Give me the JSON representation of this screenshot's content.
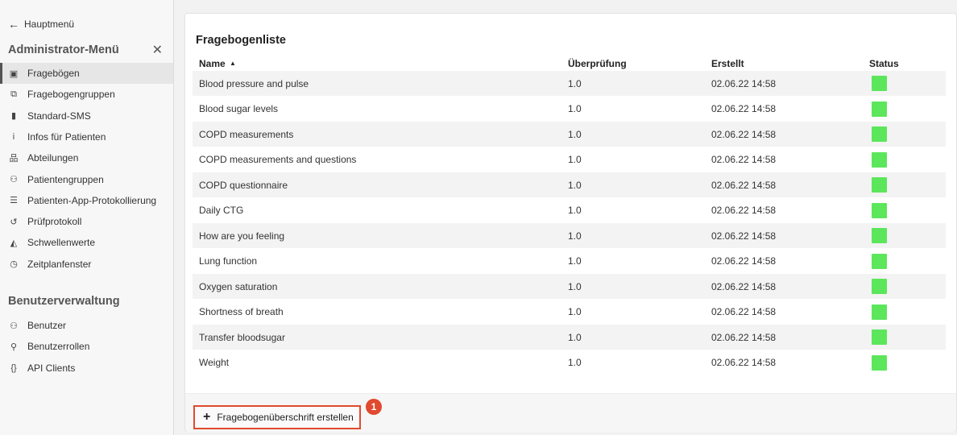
{
  "sidebar": {
    "back_label": "Hauptmenü",
    "menu_title": "Administrator-Menü",
    "close_glyph": "✕",
    "items": [
      {
        "label": "Fragebögen",
        "icon": "document-icon",
        "glyph": "▣"
      },
      {
        "label": "Fragebogengruppen",
        "icon": "documents-icon",
        "glyph": "⧉"
      },
      {
        "label": "Standard-SMS",
        "icon": "phone-icon",
        "glyph": "▮"
      },
      {
        "label": "Infos für Patienten",
        "icon": "info-icon",
        "glyph": "i"
      },
      {
        "label": "Abteilungen",
        "icon": "hierarchy-icon",
        "glyph": "品"
      },
      {
        "label": "Patientengruppen",
        "icon": "patient-group-icon",
        "glyph": "⚇"
      },
      {
        "label": "Patienten-App-Protokollierung",
        "icon": "log-lines-icon",
        "glyph": "☰"
      },
      {
        "label": "Prüfprotokoll",
        "icon": "history-icon",
        "glyph": "↺"
      },
      {
        "label": "Schwellenwerte",
        "icon": "threshold-icon",
        "glyph": "◭"
      },
      {
        "label": "Zeitplanfenster",
        "icon": "clock-icon",
        "glyph": "◷"
      }
    ],
    "user_section_title": "Benutzerverwaltung",
    "user_items": [
      {
        "label": "Benutzer",
        "icon": "users-icon",
        "glyph": "⚇"
      },
      {
        "label": "Benutzerrollen",
        "icon": "user-roles-icon",
        "glyph": "⚲"
      },
      {
        "label": "API Clients",
        "icon": "braces-icon",
        "glyph": "{}"
      }
    ]
  },
  "main": {
    "title": "Fragebogenliste",
    "columns": {
      "name": "Name",
      "sort_glyph": "▲",
      "review": "Überprüfung",
      "created": "Erstellt",
      "status": "Status"
    },
    "status_color": "#5ce65c",
    "rows": [
      {
        "name": "Blood pressure and pulse",
        "review": "1.0",
        "created": "02.06.22 14:58"
      },
      {
        "name": "Blood sugar levels",
        "review": "1.0",
        "created": "02.06.22 14:58"
      },
      {
        "name": "COPD measurements",
        "review": "1.0",
        "created": "02.06.22 14:58"
      },
      {
        "name": "COPD measurements and questions",
        "review": "1.0",
        "created": "02.06.22 14:58"
      },
      {
        "name": "COPD questionnaire",
        "review": "1.0",
        "created": "02.06.22 14:58"
      },
      {
        "name": "Daily CTG",
        "review": "1.0",
        "created": "02.06.22 14:58"
      },
      {
        "name": "How are you feeling",
        "review": "1.0",
        "created": "02.06.22 14:58"
      },
      {
        "name": "Lung function",
        "review": "1.0",
        "created": "02.06.22 14:58"
      },
      {
        "name": "Oxygen saturation",
        "review": "1.0",
        "created": "02.06.22 14:58"
      },
      {
        "name": "Shortness of breath",
        "review": "1.0",
        "created": "02.06.22 14:58"
      },
      {
        "name": "Transfer bloodsugar",
        "review": "1.0",
        "created": "02.06.22 14:58"
      },
      {
        "name": "Weight",
        "review": "1.0",
        "created": "02.06.22 14:58"
      }
    ],
    "create_button_label": "Fragebogenüberschrift erstellen",
    "create_button_glyph": "+",
    "callout_number": "1"
  }
}
